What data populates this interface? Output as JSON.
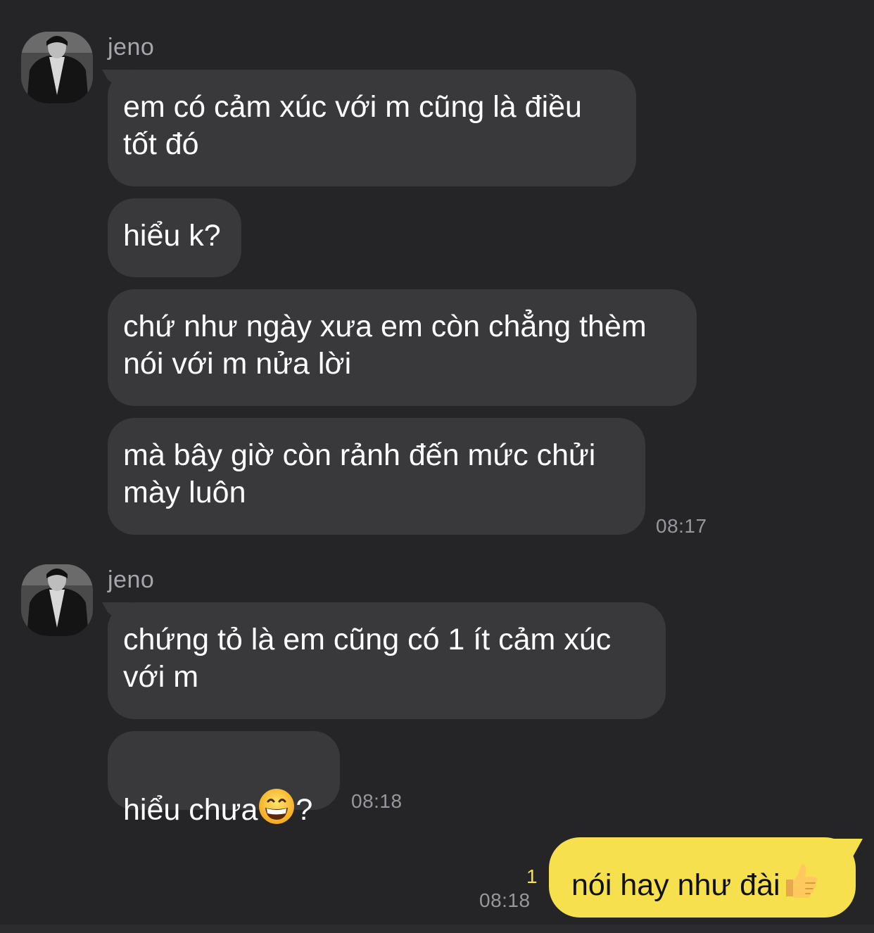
{
  "colors": {
    "background": "#252527",
    "incoming_bubble": "#39393c",
    "outgoing_bubble": "#f7e04d",
    "meta_text": "#97979c"
  },
  "groups": [
    {
      "sender": "jeno",
      "avatar_icon": "profile-photo-icon",
      "messages": [
        "em có cảm xúc với m cũng là điều\ntốt đó",
        "hiểu k?",
        "chứ như ngày xưa em còn chẳng thèm\nnói với m nửa lời",
        "mà bây giờ còn rảnh đến mức chửi\nmày luôn"
      ],
      "time": "08:17"
    },
    {
      "sender": "jeno",
      "avatar_icon": "profile-photo-icon",
      "messages": [
        "chứng tỏ là em cũng có 1 ít cảm xúc\nvới m",
        "hiểu chưa"
      ],
      "last_message_suffix": "?",
      "last_message_emoji": "grinning-face-icon",
      "time": "08:18"
    }
  ],
  "outgoing": {
    "text": "nói hay như đài",
    "emoji": "thumbs-up-icon",
    "unread_count": "1",
    "time": "08:18"
  }
}
